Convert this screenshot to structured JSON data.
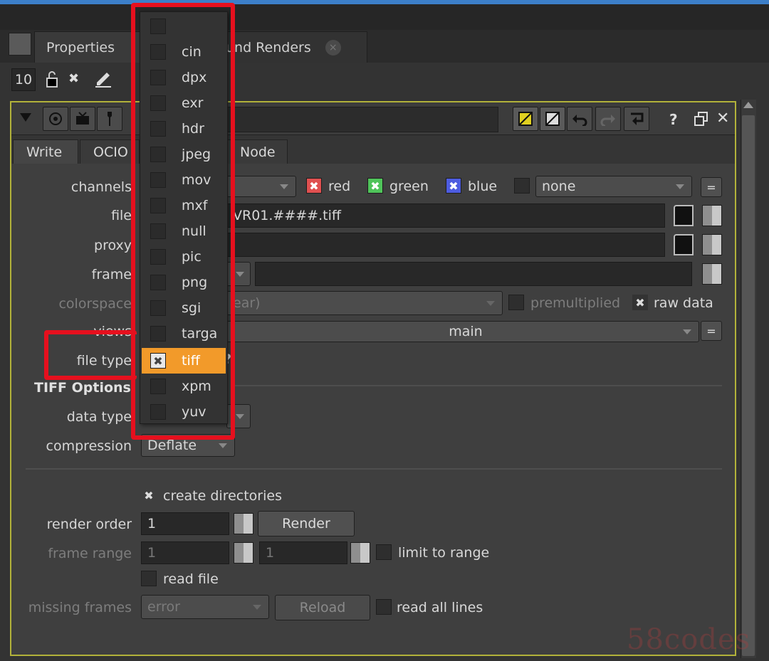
{
  "panel_tabs": {
    "properties": "Properties",
    "background_renders": "und Renders",
    "close_glyph": "×"
  },
  "toolbar": {
    "max_panels": "10"
  },
  "node_tabs": [
    "Write",
    "OCIO",
    "Node"
  ],
  "knobs": {
    "channels_label": "channels",
    "red": "red",
    "green": "green",
    "blue": "blue",
    "alpha_channel": "none",
    "equals": "=",
    "file_label": "file",
    "file_value": "VR01.####.tiff",
    "proxy_label": "proxy",
    "frame_label": "frame",
    "colorspace_label": "colorspace",
    "colorspace_value": "ear)",
    "premultiplied": "premultiplied",
    "raw_data": "raw data",
    "views_label": "views",
    "views_value": "main",
    "file_type_label": "file type",
    "file_type_help": "?",
    "tiff_options": "TIFF Options",
    "data_type_label": "data type",
    "compression_label": "compression",
    "compression_value": "Deflate",
    "create_directories": "create directories",
    "render_order_label": "render order",
    "render_order_value": "1",
    "render_button": "Render",
    "frame_range_label": "frame range",
    "frame_range_start": "1",
    "frame_range_end": "1",
    "limit_to_range": "limit to range",
    "read_file": "read file",
    "missing_frames_label": "missing frames",
    "missing_frames_value": "error",
    "reload_button": "Reload",
    "read_all_lines": "read all lines"
  },
  "file_type_menu": {
    "items": [
      "",
      "cin",
      "dpx",
      "exr",
      "hdr",
      "jpeg",
      "mov",
      "mxf",
      "null",
      "pic",
      "png",
      "sgi",
      "targa",
      "tiff",
      "xpm",
      "yuv"
    ],
    "selected": "tiff"
  },
  "colors": {
    "highlight": "#f29a2a",
    "annotation": "#e6101e",
    "node_border": "#b2b23a"
  },
  "watermark": "58codes"
}
